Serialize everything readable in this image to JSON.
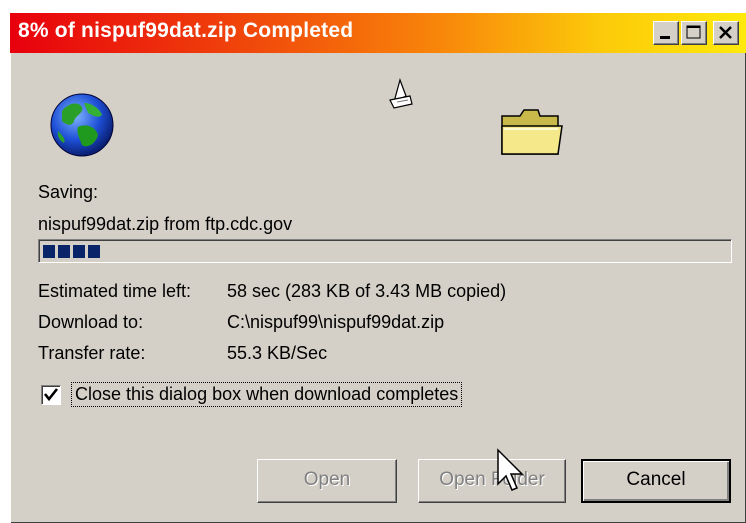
{
  "window": {
    "title": "8% of nispuf99dat.zip Completed",
    "controls": [
      "minimize",
      "maximize",
      "close"
    ]
  },
  "animation": {
    "icons": [
      "globe-icon",
      "paper-document-icon",
      "folder-icon"
    ]
  },
  "status": {
    "saving_label": "Saving:",
    "saving_value": "nispuf99dat.zip from ftp.cdc.gov",
    "progress_percent": 8
  },
  "details": {
    "time_label": "Estimated time left:",
    "time_value": "58 sec (283 KB of 3.43 MB copied)",
    "download_label": "Download to:",
    "download_value": "C:\\nispuf99\\nispuf99dat.zip",
    "rate_label": "Transfer rate:",
    "rate_value": "55.3 KB/Sec"
  },
  "options": {
    "close_on_complete_label": "Close this dialog box when download completes",
    "close_on_complete_checked": true
  },
  "buttons": {
    "open_label": "Open",
    "open_folder_label": "Open Folder",
    "cancel_label": "Cancel"
  },
  "colors": {
    "title_gradient_start": "#e8000d",
    "title_gradient_end": "#ffea0c",
    "progress_fill": "#0a246a",
    "dialog_face": "#d4d0c8"
  }
}
